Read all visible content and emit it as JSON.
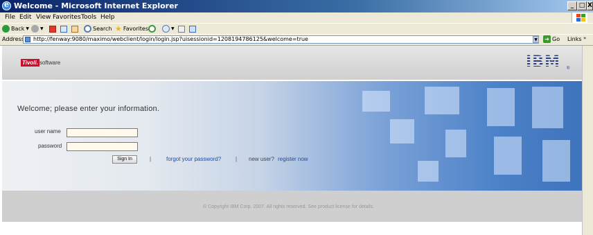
{
  "window": {
    "title": "Welcome - Microsoft Internet Explorer",
    "buttons": {
      "minimize": "_",
      "maximize": "□",
      "close": "X"
    }
  },
  "menu": [
    "File",
    "Edit",
    "View",
    "Favorites",
    "Tools",
    "Help"
  ],
  "toolbar": {
    "back_label": "Back",
    "search_label": "Search",
    "favorites_label": "Favorites"
  },
  "address": {
    "label": "Address",
    "url": "http://fenway:9080/maximo/webclient/login/login.jsp?uisessionid=1208194786125&welcome=true",
    "go_label": "Go",
    "links_label": "Links"
  },
  "brand": {
    "tivoli": "Tivoli.",
    "software": "software",
    "ibm": "IBM",
    "ibm_mark": "®"
  },
  "login": {
    "welcome": "Welcome; please enter your information.",
    "username_label": "user name",
    "password_label": "password",
    "username_value": "",
    "password_value": "",
    "signin_label": "Sign In",
    "separator": "|",
    "forgot_link": "forgot your password?",
    "new_user_text": "new user?",
    "register_link": "register now"
  },
  "footer": {
    "copyright": "© Copyright IBM Corp. 2007. All rights reserved. See product license for details."
  },
  "colors": {
    "titlebar": "#0a246a",
    "tivoli_red": "#c8102e",
    "link_blue": "#1a4ba8",
    "band_blue": "#3e73bd"
  }
}
